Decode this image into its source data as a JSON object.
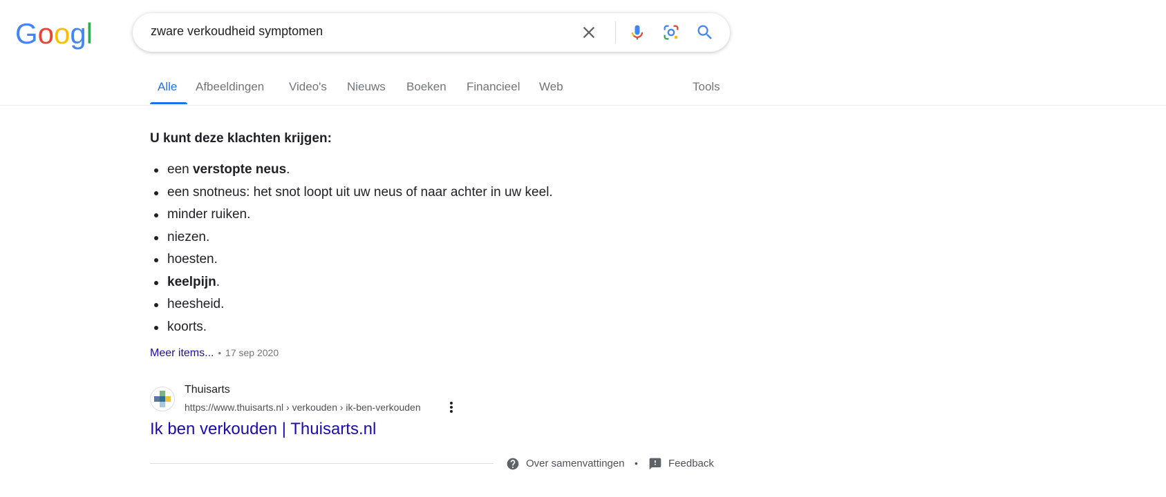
{
  "logo": {
    "text": "Google",
    "letter_colors": [
      "#4285F4",
      "#EA4335",
      "#FBBC05",
      "#4285F4",
      "#34A853",
      "#EA4335"
    ]
  },
  "search": {
    "query": "zware verkoudheid symptomen",
    "icons": {
      "clear": "close-icon",
      "voice": "mic-icon",
      "lens": "lens-icon",
      "search": "search-icon"
    }
  },
  "tabs": [
    {
      "label": "Alle",
      "active": true
    },
    {
      "label": "Afbeeldingen",
      "active": false
    },
    {
      "label": "Video's",
      "active": false
    },
    {
      "label": "Nieuws",
      "active": false
    },
    {
      "label": "Boeken",
      "active": false
    },
    {
      "label": "Financieel",
      "active": false
    },
    {
      "label": "Web",
      "active": false
    }
  ],
  "tools_label": "Tools",
  "snippet": {
    "heading": "U kunt deze klachten krijgen:",
    "items": [
      {
        "prefix": "een ",
        "bold": "verstopte neus",
        "suffix": "."
      },
      {
        "prefix": "een snotneus: het snot loopt uit uw neus of naar achter in uw keel.",
        "bold": "",
        "suffix": ""
      },
      {
        "prefix": "minder ruiken.",
        "bold": "",
        "suffix": ""
      },
      {
        "prefix": "niezen.",
        "bold": "",
        "suffix": ""
      },
      {
        "prefix": "hoesten.",
        "bold": "",
        "suffix": ""
      },
      {
        "prefix": "",
        "bold": "keelpijn",
        "suffix": "."
      },
      {
        "prefix": "heesheid.",
        "bold": "",
        "suffix": ""
      },
      {
        "prefix": "koorts.",
        "bold": "",
        "suffix": ""
      }
    ],
    "more_items": "Meer items...",
    "separator": "•",
    "date": "17 sep 2020"
  },
  "result": {
    "site_name": "Thuisarts",
    "url": "https://www.thuisarts.nl › verkouden › ik-ben-verkouden",
    "title": "Ik ben verkouden | Thuisarts.nl"
  },
  "footer": {
    "about": "Over samenvattingen",
    "separator": "•",
    "feedback": "Feedback"
  },
  "colors": {
    "link": "#1a0dab",
    "accent": "#1a73e8",
    "text": "#202124",
    "muted": "#70757a"
  }
}
